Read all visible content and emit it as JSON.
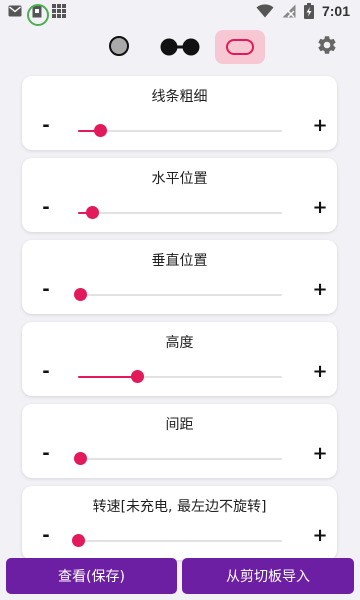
{
  "status_bar": {
    "time": "7:01",
    "icons": [
      "mail-icon",
      "sd-card-icon",
      "grid-icon",
      "wifi-icon",
      "no-signal-icon",
      "battery-charging-icon"
    ]
  },
  "modes": {
    "items": [
      "gray-dot-mode-icon",
      "glasses-mode-icon",
      "pill-mode-icon"
    ],
    "selected": "pill-mode-icon"
  },
  "settings": {
    "line_thickness": {
      "label": "线条粗细",
      "value": 0.11,
      "minus": "-",
      "plus": "+"
    },
    "horizontal_position": {
      "label": "水平位置",
      "value": 0.07,
      "minus": "-",
      "plus": "+"
    },
    "vertical_position": {
      "label": "垂直位置",
      "value": 0.01,
      "minus": "-",
      "plus": "+"
    },
    "height": {
      "label": "高度",
      "value": 0.29,
      "minus": "-",
      "plus": "+"
    },
    "spacing": {
      "label": "间距",
      "value": 0.01,
      "minus": "-",
      "plus": "+"
    },
    "rotation_speed": {
      "label": "转速[未充电, 最左边不旋转]",
      "value": 0.0,
      "minus": "-",
      "plus": "+"
    }
  },
  "buttons": {
    "view_save": "查看(保存)",
    "import_clipboard": "从剪切板导入"
  },
  "colors": {
    "accent": "#e2195a",
    "button": "#6d1fa3",
    "selected_bg": "#f8c7d4"
  }
}
